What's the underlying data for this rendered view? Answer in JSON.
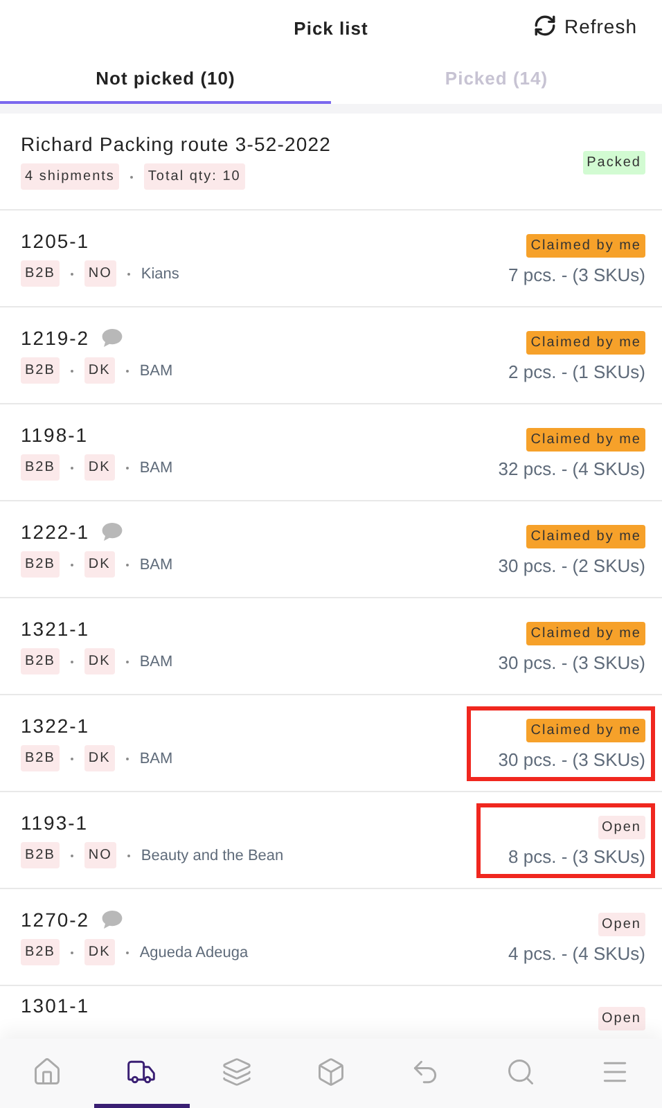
{
  "header": {
    "title": "Pick list",
    "refresh": "Refresh"
  },
  "tabs": [
    {
      "label": "Not picked (10)",
      "selected": true
    },
    {
      "label": "Picked (14)",
      "selected": false
    }
  ],
  "route": {
    "title": "Richard Packing route 3-52-2022",
    "tags": [
      "4 shipments",
      "Total qty: 10"
    ],
    "status": {
      "label": "Packed",
      "kind": "packed"
    }
  },
  "orders": [
    {
      "number": "1205-1",
      "comment": false,
      "tags": [
        "B2B",
        "NO"
      ],
      "customer": "Kians",
      "status": {
        "label": "Claimed by me",
        "kind": "claimed"
      },
      "quantity": "7 pcs. - (3 SKUs)",
      "highlighted": false
    },
    {
      "number": "1219-2",
      "comment": true,
      "tags": [
        "B2B",
        "DK"
      ],
      "customer": "BAM",
      "status": {
        "label": "Claimed by me",
        "kind": "claimed"
      },
      "quantity": "2 pcs. - (1 SKUs)",
      "highlighted": false
    },
    {
      "number": "1198-1",
      "comment": false,
      "tags": [
        "B2B",
        "DK"
      ],
      "customer": "BAM",
      "status": {
        "label": "Claimed by me",
        "kind": "claimed"
      },
      "quantity": "32 pcs. - (4 SKUs)",
      "highlighted": false
    },
    {
      "number": "1222-1",
      "comment": true,
      "tags": [
        "B2B",
        "DK"
      ],
      "customer": "BAM",
      "status": {
        "label": "Claimed by me",
        "kind": "claimed"
      },
      "quantity": "30 pcs. - (2 SKUs)",
      "highlighted": false
    },
    {
      "number": "1321-1",
      "comment": false,
      "tags": [
        "B2B",
        "DK"
      ],
      "customer": "BAM",
      "status": {
        "label": "Claimed by me",
        "kind": "claimed"
      },
      "quantity": "30 pcs. - (3 SKUs)",
      "highlighted": false
    },
    {
      "number": "1322-1",
      "comment": false,
      "tags": [
        "B2B",
        "DK"
      ],
      "customer": "BAM",
      "status": {
        "label": "Claimed by me",
        "kind": "claimed"
      },
      "quantity": "30 pcs. - (3 SKUs)",
      "highlighted": true
    },
    {
      "number": "1193-1",
      "comment": false,
      "tags": [
        "B2B",
        "NO"
      ],
      "customer": "Beauty and the Bean",
      "status": {
        "label": "Open",
        "kind": "open"
      },
      "quantity": "8 pcs. - (3 SKUs)",
      "highlighted": true
    },
    {
      "number": "1270-2",
      "comment": true,
      "tags": [
        "B2B",
        "DK"
      ],
      "customer": "Agueda Adeuga",
      "status": {
        "label": "Open",
        "kind": "open"
      },
      "quantity": "4 pcs. - (4 SKUs)",
      "highlighted": false
    },
    {
      "number": "1301-1",
      "comment": false,
      "status": {
        "label": "Open",
        "kind": "open"
      },
      "highlighted": false
    }
  ],
  "nav": [
    {
      "kind": "home",
      "selected": false
    },
    {
      "kind": "truck",
      "selected": true
    },
    {
      "kind": "layers",
      "selected": false
    },
    {
      "kind": "box",
      "selected": false
    },
    {
      "kind": "return",
      "selected": false
    },
    {
      "kind": "search",
      "selected": false
    },
    {
      "kind": "menu",
      "selected": false
    }
  ]
}
